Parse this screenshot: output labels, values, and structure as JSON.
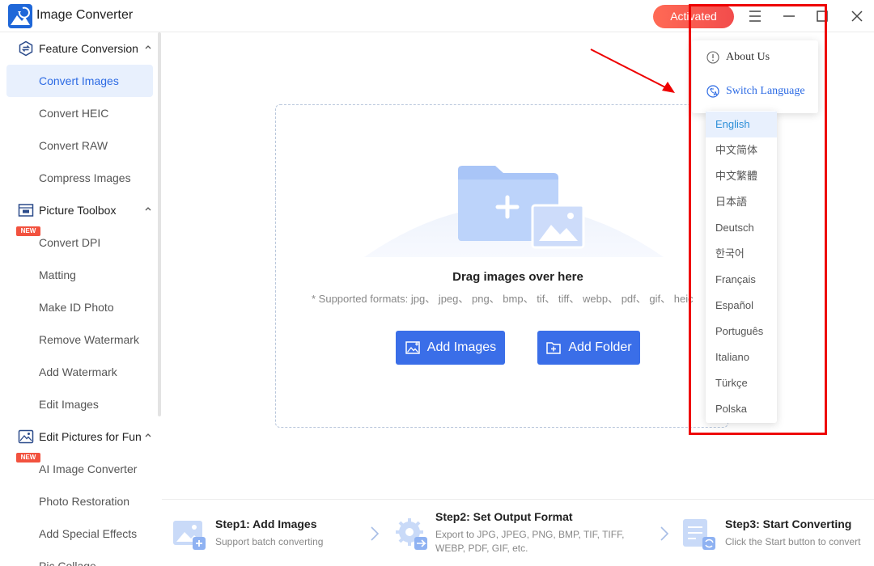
{
  "app": {
    "title": "Image Converter"
  },
  "header": {
    "activated_label": "Activated"
  },
  "sidebar": {
    "sections": [
      {
        "label": "Feature Conversion",
        "icon": "swap-icon"
      },
      {
        "label": "Picture Toolbox",
        "icon": "toolbox-icon"
      },
      {
        "label": "Edit Pictures for Fun",
        "icon": "image-edit-icon"
      }
    ],
    "items": [
      {
        "label": "Convert Images",
        "active": true
      },
      {
        "label": "Convert HEIC"
      },
      {
        "label": "Convert RAW"
      },
      {
        "label": "Compress Images"
      },
      {
        "label": "Convert DPI",
        "badge": "NEW"
      },
      {
        "label": "Matting"
      },
      {
        "label": "Make ID Photo"
      },
      {
        "label": "Remove Watermark"
      },
      {
        "label": "Add Watermark"
      },
      {
        "label": "Edit Images"
      },
      {
        "label": "AI Image Converter",
        "badge": "NEW"
      },
      {
        "label": "Photo Restoration"
      },
      {
        "label": "Add Special Effects"
      },
      {
        "label": "Pic Collage"
      }
    ]
  },
  "dropzone": {
    "title": "Drag images over here",
    "formats": "* Supported formats: jpg、 jpeg、 png、 bmp、 tif、 tiff、 webp、 pdf、 gif、 heic",
    "add_images_label": "Add Images",
    "add_folder_label": "Add Folder"
  },
  "steps": [
    {
      "title": "Step1:  Add Images",
      "desc": "Support batch converting"
    },
    {
      "title": "Step2:  Set Output Format",
      "desc_line1": "Export to JPG, JPEG, PNG, BMP, TIF, TIFF,",
      "desc_line2": "WEBP, PDF, GIF, etc."
    },
    {
      "title": "Step3:  Start Converting",
      "desc": "Click the Start button to convert"
    }
  ],
  "menu": {
    "about_label": "About Us",
    "switch_language_label": "Switch Language"
  },
  "languages": {
    "selected": "English",
    "options": [
      "English",
      "中文简体",
      "中文繁體",
      "日本語",
      "Deutsch",
      "한국어",
      "Français",
      "Español",
      "Português",
      "Italiano",
      "Türkçe",
      "Polska"
    ]
  },
  "colors": {
    "accent": "#3a6ee8",
    "activated": "#f24c4c",
    "annotation": "#ee0000",
    "active_bg": "#e8f0fd"
  }
}
